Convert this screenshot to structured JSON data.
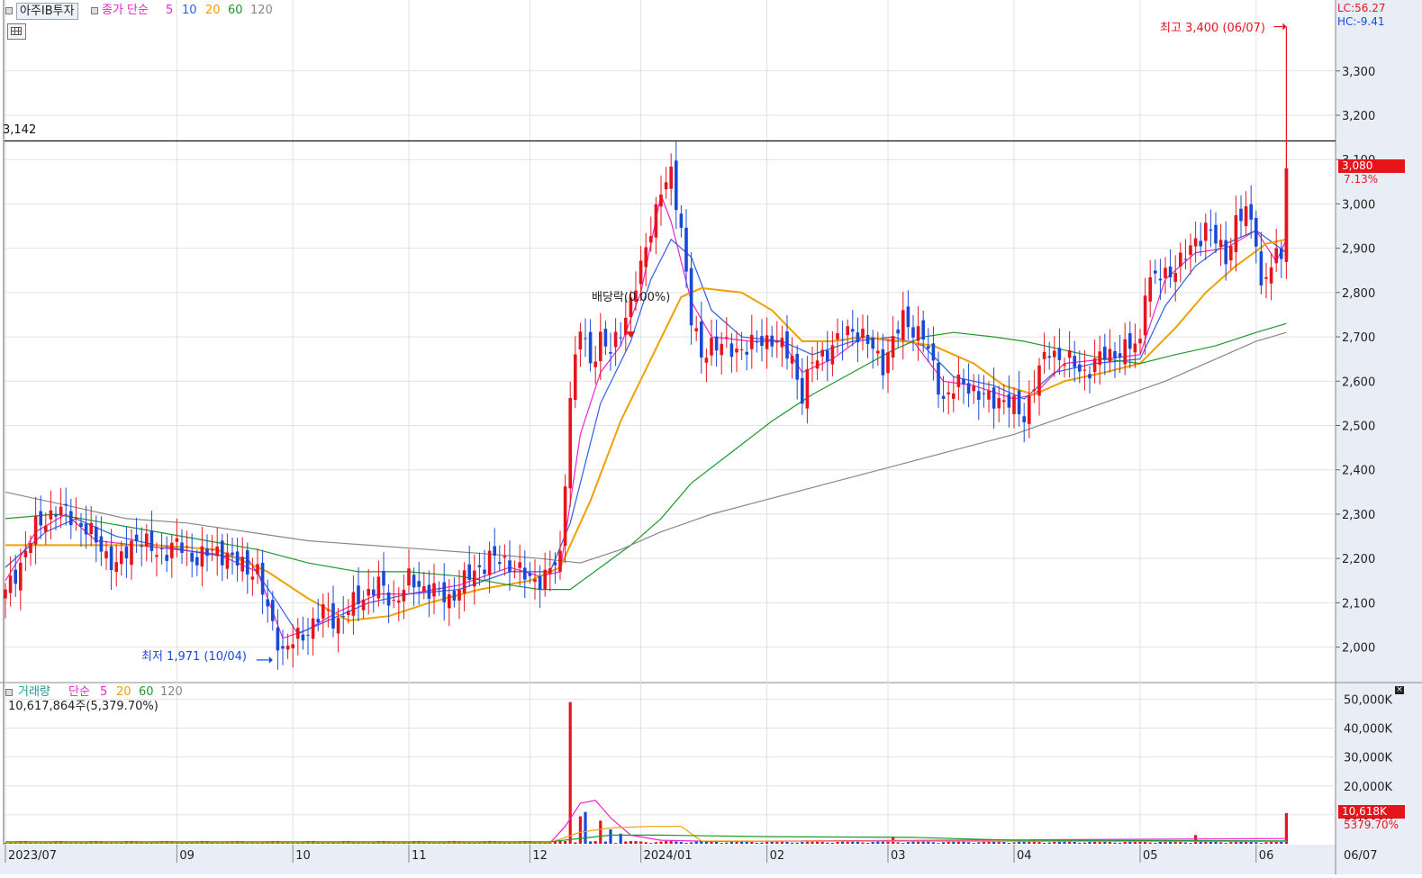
{
  "toolbar": {
    "symbol": "아주IB투자",
    "price_ma_label": "종가 단순",
    "ma_periods": [
      "5",
      "10",
      "20",
      "60",
      "120"
    ],
    "volume_label": "거래량",
    "volume_ma_label": "단순",
    "volume_ma_periods": [
      "5",
      "20",
      "60",
      "120"
    ]
  },
  "info": {
    "lc": "LC:56.27",
    "hc": "HC:-9.41",
    "current_price": "3,080",
    "change_pct": "7.13%",
    "volume_text": "10,617,864주(5,379.70%)",
    "volume_current": "10,618K",
    "volume_pct": "5379.70%"
  },
  "colors": {
    "up": "#e8141c",
    "down": "#1a49d8",
    "ma5": "#ee22cc",
    "ma10": "#2f5fe8",
    "ma20": "#f0a000",
    "ma60": "#1b9a2c",
    "ma120": "#888888",
    "axis_bg": "#e9edf5"
  },
  "chart_data": {
    "type": "candlestick",
    "y_axis": {
      "ticks": [
        2000,
        2100,
        2200,
        2300,
        2400,
        2500,
        2600,
        2700,
        2800,
        2900,
        3000,
        3100,
        3200,
        3300
      ],
      "tick_labels": [
        "2,000",
        "2,100",
        "2,200",
        "2,300",
        "2,400",
        "2,500",
        "2,600",
        "2,700",
        "2,800",
        "2,900",
        "3,000",
        "3,100",
        "3,200",
        "3,300"
      ],
      "ylim": [
        1920,
        3460
      ]
    },
    "x_axis": {
      "tick_labels": [
        "2023/07",
        "09",
        "10",
        "11",
        "12",
        "2024/01",
        "02",
        "03",
        "04",
        "05",
        "06",
        "06/07"
      ],
      "tick_sessions": [
        0,
        34,
        57,
        80,
        104,
        126,
        151,
        175,
        200,
        225,
        248,
        263
      ]
    },
    "reference_line": {
      "value": 3142,
      "label": "3,142"
    },
    "annotations": {
      "high": {
        "label": "최고 3,400 (06/07)",
        "value": 3400
      },
      "low": {
        "label": "최저 1,971 (10/04)",
        "value": 1971
      },
      "dividend": {
        "label": "배당락(0.00%)",
        "value": 2710
      }
    },
    "legend": [
      "5",
      "10",
      "20",
      "60",
      "120"
    ],
    "segments": [
      [
        0,
        2120
      ],
      [
        3,
        2190
      ],
      [
        6,
        2270
      ],
      [
        10,
        2310
      ],
      [
        14,
        2290
      ],
      [
        18,
        2240
      ],
      [
        22,
        2180
      ],
      [
        26,
        2250
      ],
      [
        30,
        2210
      ],
      [
        34,
        2230
      ],
      [
        38,
        2200
      ],
      [
        42,
        2220
      ],
      [
        46,
        2190
      ],
      [
        50,
        2170
      ],
      [
        52,
        2080
      ],
      [
        55,
        1990
      ],
      [
        57,
        2010
      ],
      [
        60,
        2040
      ],
      [
        63,
        2080
      ],
      [
        66,
        2060
      ],
      [
        70,
        2110
      ],
      [
        74,
        2140
      ],
      [
        77,
        2100
      ],
      [
        80,
        2150
      ],
      [
        84,
        2130
      ],
      [
        88,
        2110
      ],
      [
        92,
        2160
      ],
      [
        96,
        2200
      ],
      [
        100,
        2190
      ],
      [
        104,
        2150
      ],
      [
        107,
        2160
      ],
      [
        110,
        2200
      ],
      [
        112,
        2570
      ],
      [
        114,
        2720
      ],
      [
        116,
        2640
      ],
      [
        118,
        2700
      ],
      [
        120,
        2660
      ],
      [
        122,
        2720
      ],
      [
        124,
        2780
      ],
      [
        126,
        2850
      ],
      [
        128,
        2950
      ],
      [
        130,
        3030
      ],
      [
        132,
        3060
      ],
      [
        134,
        2950
      ],
      [
        136,
        2740
      ],
      [
        138,
        2650
      ],
      [
        140,
        2690
      ],
      [
        144,
        2670
      ],
      [
        148,
        2680
      ],
      [
        152,
        2700
      ],
      [
        156,
        2650
      ],
      [
        158,
        2570
      ],
      [
        160,
        2640
      ],
      [
        164,
        2680
      ],
      [
        168,
        2720
      ],
      [
        170,
        2700
      ],
      [
        174,
        2640
      ],
      [
        178,
        2740
      ],
      [
        180,
        2720
      ],
      [
        182,
        2700
      ],
      [
        184,
        2630
      ],
      [
        186,
        2560
      ],
      [
        190,
        2600
      ],
      [
        194,
        2560
      ],
      [
        198,
        2560
      ],
      [
        200,
        2540
      ],
      [
        202,
        2520
      ],
      [
        204,
        2600
      ],
      [
        207,
        2670
      ],
      [
        210,
        2650
      ],
      [
        214,
        2620
      ],
      [
        218,
        2660
      ],
      [
        222,
        2670
      ],
      [
        225,
        2690
      ],
      [
        226,
        2820
      ],
      [
        230,
        2840
      ],
      [
        234,
        2880
      ],
      [
        238,
        2950
      ],
      [
        242,
        2880
      ],
      [
        244,
        2960
      ],
      [
        246,
        2980
      ],
      [
        248,
        2930
      ],
      [
        249,
        2810
      ],
      [
        251,
        2860
      ],
      [
        253,
        2890
      ],
      [
        254,
        3080
      ]
    ],
    "ma_lines": [
      {
        "name": "5",
        "points": [
          [
            0,
            2150
          ],
          [
            6,
            2260
          ],
          [
            12,
            2300
          ],
          [
            18,
            2240
          ],
          [
            26,
            2230
          ],
          [
            34,
            2220
          ],
          [
            42,
            2210
          ],
          [
            50,
            2170
          ],
          [
            55,
            2020
          ],
          [
            60,
            2040
          ],
          [
            66,
            2080
          ],
          [
            74,
            2120
          ],
          [
            80,
            2120
          ],
          [
            90,
            2140
          ],
          [
            100,
            2180
          ],
          [
            106,
            2160
          ],
          [
            110,
            2170
          ],
          [
            114,
            2480
          ],
          [
            118,
            2620
          ],
          [
            122,
            2680
          ],
          [
            126,
            2800
          ],
          [
            130,
            3020
          ],
          [
            132,
            2960
          ],
          [
            136,
            2780
          ],
          [
            140,
            2700
          ],
          [
            148,
            2690
          ],
          [
            154,
            2690
          ],
          [
            158,
            2620
          ],
          [
            164,
            2650
          ],
          [
            170,
            2700
          ],
          [
            176,
            2690
          ],
          [
            180,
            2690
          ],
          [
            186,
            2600
          ],
          [
            192,
            2590
          ],
          [
            200,
            2560
          ],
          [
            204,
            2570
          ],
          [
            210,
            2640
          ],
          [
            218,
            2650
          ],
          [
            225,
            2660
          ],
          [
            230,
            2830
          ],
          [
            236,
            2890
          ],
          [
            242,
            2900
          ],
          [
            248,
            2940
          ],
          [
            252,
            2870
          ],
          [
            254,
            2920
          ]
        ]
      },
      {
        "name": "10",
        "points": [
          [
            0,
            2180
          ],
          [
            8,
            2260
          ],
          [
            14,
            2290
          ],
          [
            22,
            2250
          ],
          [
            30,
            2230
          ],
          [
            40,
            2210
          ],
          [
            48,
            2200
          ],
          [
            54,
            2100
          ],
          [
            58,
            2030
          ],
          [
            64,
            2060
          ],
          [
            72,
            2100
          ],
          [
            80,
            2120
          ],
          [
            90,
            2130
          ],
          [
            100,
            2170
          ],
          [
            108,
            2170
          ],
          [
            112,
            2280
          ],
          [
            118,
            2550
          ],
          [
            124,
            2690
          ],
          [
            128,
            2830
          ],
          [
            132,
            2920
          ],
          [
            136,
            2880
          ],
          [
            140,
            2760
          ],
          [
            146,
            2700
          ],
          [
            154,
            2690
          ],
          [
            160,
            2660
          ],
          [
            168,
            2690
          ],
          [
            176,
            2700
          ],
          [
            182,
            2680
          ],
          [
            188,
            2610
          ],
          [
            196,
            2590
          ],
          [
            202,
            2560
          ],
          [
            208,
            2620
          ],
          [
            216,
            2640
          ],
          [
            225,
            2650
          ],
          [
            230,
            2770
          ],
          [
            236,
            2860
          ],
          [
            242,
            2910
          ],
          [
            248,
            2940
          ],
          [
            254,
            2890
          ]
        ]
      },
      {
        "name": "20",
        "points": [
          [
            0,
            2230
          ],
          [
            10,
            2230
          ],
          [
            20,
            2230
          ],
          [
            30,
            2230
          ],
          [
            42,
            2220
          ],
          [
            52,
            2170
          ],
          [
            60,
            2110
          ],
          [
            68,
            2060
          ],
          [
            76,
            2070
          ],
          [
            84,
            2100
          ],
          [
            94,
            2130
          ],
          [
            104,
            2150
          ],
          [
            110,
            2180
          ],
          [
            116,
            2330
          ],
          [
            122,
            2510
          ],
          [
            128,
            2650
          ],
          [
            134,
            2790
          ],
          [
            138,
            2810
          ],
          [
            146,
            2800
          ],
          [
            152,
            2760
          ],
          [
            158,
            2690
          ],
          [
            164,
            2690
          ],
          [
            170,
            2700
          ],
          [
            178,
            2690
          ],
          [
            184,
            2680
          ],
          [
            192,
            2640
          ],
          [
            198,
            2590
          ],
          [
            204,
            2570
          ],
          [
            210,
            2600
          ],
          [
            218,
            2620
          ],
          [
            225,
            2640
          ],
          [
            232,
            2720
          ],
          [
            238,
            2800
          ],
          [
            244,
            2860
          ],
          [
            250,
            2910
          ],
          [
            254,
            2920
          ]
        ]
      },
      {
        "name": "60",
        "points": [
          [
            0,
            2290
          ],
          [
            10,
            2300
          ],
          [
            20,
            2280
          ],
          [
            30,
            2260
          ],
          [
            40,
            2240
          ],
          [
            50,
            2220
          ],
          [
            60,
            2190
          ],
          [
            70,
            2170
          ],
          [
            80,
            2170
          ],
          [
            90,
            2160
          ],
          [
            100,
            2140
          ],
          [
            106,
            2130
          ],
          [
            112,
            2130
          ],
          [
            118,
            2180
          ],
          [
            124,
            2230
          ],
          [
            130,
            2290
          ],
          [
            136,
            2370
          ],
          [
            144,
            2440
          ],
          [
            152,
            2510
          ],
          [
            160,
            2570
          ],
          [
            168,
            2620
          ],
          [
            176,
            2670
          ],
          [
            182,
            2700
          ],
          [
            188,
            2710
          ],
          [
            196,
            2700
          ],
          [
            202,
            2690
          ],
          [
            210,
            2670
          ],
          [
            218,
            2650
          ],
          [
            225,
            2640
          ],
          [
            232,
            2660
          ],
          [
            240,
            2680
          ],
          [
            248,
            2710
          ],
          [
            254,
            2730
          ]
        ]
      },
      {
        "name": "120",
        "points": [
          [
            0,
            2350
          ],
          [
            12,
            2320
          ],
          [
            24,
            2290
          ],
          [
            36,
            2280
          ],
          [
            48,
            2260
          ],
          [
            60,
            2240
          ],
          [
            72,
            2230
          ],
          [
            84,
            2220
          ],
          [
            96,
            2210
          ],
          [
            106,
            2200
          ],
          [
            114,
            2190
          ],
          [
            122,
            2220
          ],
          [
            130,
            2260
          ],
          [
            140,
            2300
          ],
          [
            150,
            2330
          ],
          [
            160,
            2360
          ],
          [
            170,
            2390
          ],
          [
            180,
            2420
          ],
          [
            190,
            2450
          ],
          [
            200,
            2480
          ],
          [
            210,
            2520
          ],
          [
            220,
            2560
          ],
          [
            230,
            2600
          ],
          [
            240,
            2650
          ],
          [
            248,
            2690
          ],
          [
            254,
            2710
          ]
        ]
      }
    ],
    "volume": {
      "y_ticks": [
        10000,
        20000,
        30000,
        40000,
        50000
      ],
      "tick_labels": [
        "10,000K",
        "20,000K",
        "30,000K",
        "40,000K",
        "50,000K"
      ],
      "ylim": [
        0,
        52000
      ],
      "spikes": [
        [
          112,
          49000
        ],
        [
          114,
          9500
        ],
        [
          115,
          11000
        ],
        [
          118,
          8000
        ],
        [
          120,
          5000
        ],
        [
          122,
          3500
        ],
        [
          176,
          2500
        ],
        [
          236,
          3000
        ],
        [
          254,
          10618
        ]
      ],
      "ma_lines": [
        {
          "name": "5",
          "points": [
            [
              0,
              300
            ],
            [
              108,
              300
            ],
            [
              111,
              6000
            ],
            [
              114,
              14000
            ],
            [
              117,
              15000
            ],
            [
              120,
              9000
            ],
            [
              124,
              3000
            ],
            [
              130,
              1200
            ],
            [
              140,
              800
            ],
            [
              254,
              1800
            ]
          ]
        },
        {
          "name": "20",
          "points": [
            [
              0,
              400
            ],
            [
              108,
              400
            ],
            [
              114,
              4000
            ],
            [
              120,
              5500
            ],
            [
              128,
              6000
            ],
            [
              134,
              6000
            ],
            [
              138,
              1000
            ],
            [
              150,
              900
            ],
            [
              254,
              800
            ]
          ]
        },
        {
          "name": "60",
          "points": [
            [
              0,
              700
            ],
            [
              108,
              700
            ],
            [
              120,
              3000
            ],
            [
              130,
              3000
            ],
            [
              150,
              2500
            ],
            [
              180,
              2200
            ],
            [
              200,
              1200
            ],
            [
              254,
              1000
            ]
          ]
        }
      ]
    }
  }
}
